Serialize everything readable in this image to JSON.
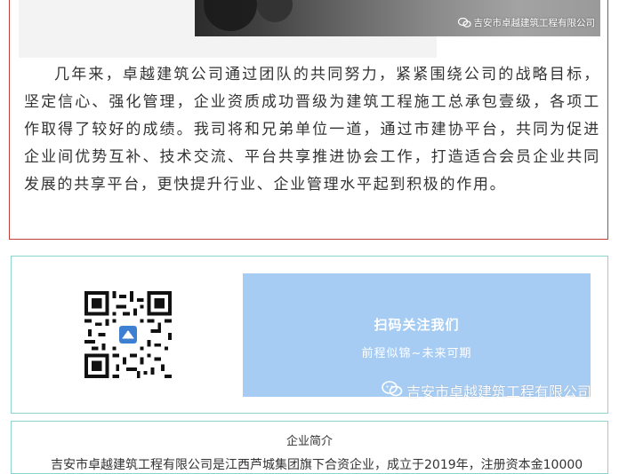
{
  "article": {
    "photo_watermark": "吉安市卓越建筑工程有限公司",
    "paragraph": "几年来，卓越建筑公司通过团队的共同努力，紧紧围绕公司的战略目标，坚定信心、强化管理，企业资质成功晋级为建筑工程施工总承包壹级，各项工作取得了较好的成绩。我司将和兄弟单位一道，通过市建协平台，共同为促进企业间优势互补、技术交流、平台共享推进协会工作，打造适合会员企业共同发展的共享平台，更快提升行业、企业管理水平起到积极的作用。"
  },
  "follow": {
    "title": "扫码关注我们",
    "subtitle": "前程似锦~未来可期",
    "watermark": "吉安市卓越建筑工程有限公司"
  },
  "intro": {
    "title": "企业简介",
    "text": "吉安市卓越建筑工程有限公司是江西芦城集团旗下合资企业，成立于2019年，注册资本金10000"
  },
  "colors": {
    "card_border_red": "#c0413a",
    "card_border_teal": "#8dd3ce",
    "follow_panel_blue": "#a6ccf3"
  },
  "icons": {
    "watermark": "wechat-icon",
    "qr": "qr-code",
    "qr_logo": "company-logo"
  }
}
